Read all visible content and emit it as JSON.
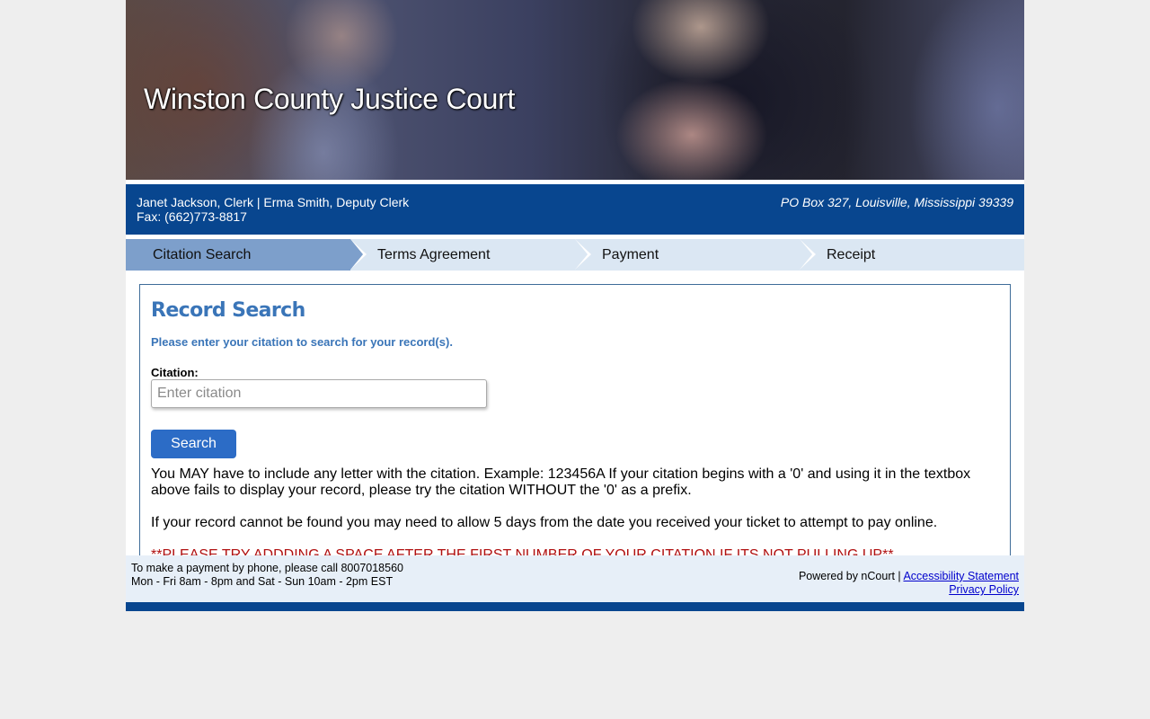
{
  "banner": {
    "title": "Winston County Justice Court"
  },
  "infobar": {
    "clerks": "Janet Jackson, Clerk | Erma Smith, Deputy Clerk",
    "fax": "Fax: (662)773-8817",
    "address": "PO Box 327, Louisville, Mississippi 39339"
  },
  "steps": [
    {
      "label": "Citation Search",
      "active": true
    },
    {
      "label": "Terms Agreement",
      "active": false
    },
    {
      "label": "Payment",
      "active": false
    },
    {
      "label": "Receipt",
      "active": false
    }
  ],
  "search": {
    "title": "Record Search",
    "subtitle": "Please enter your citation to search for your record(s).",
    "label": "Citation:",
    "placeholder": "Enter citation",
    "value": "",
    "button": "Search"
  },
  "notes": {
    "p1": "You MAY have to include any letter with the citation. Example: 123456A If your citation begins with a '0' and using it in the textbox above fails to display your record, please try the citation WITHOUT the '0' as a prefix.",
    "p2": "If your record cannot be found you may need to allow 5 days from the date you received your ticket to attempt to pay online.",
    "p3": "**PLEASE TRY ADDDING A SPACE AFTER THE FIRST NUMBER OF YOUR CITATION IF ITS NOT PULLING UP**"
  },
  "footer": {
    "phone_line": "To make a payment by phone, please call 8007018560",
    "hours": "Mon - Fri 8am - 8pm and Sat - Sun 10am - 2pm EST",
    "powered": "Powered by nCourt | ",
    "accessibility": "Accessibility Statement",
    "privacy": "Privacy Policy"
  },
  "colors": {
    "brand_blue": "#08468f",
    "step_active": "#7d9fcb",
    "step_inactive": "#dbe7f3",
    "heading_blue": "#3a75b8",
    "button_blue": "#2c6cc6",
    "warning_red": "#b01010"
  }
}
